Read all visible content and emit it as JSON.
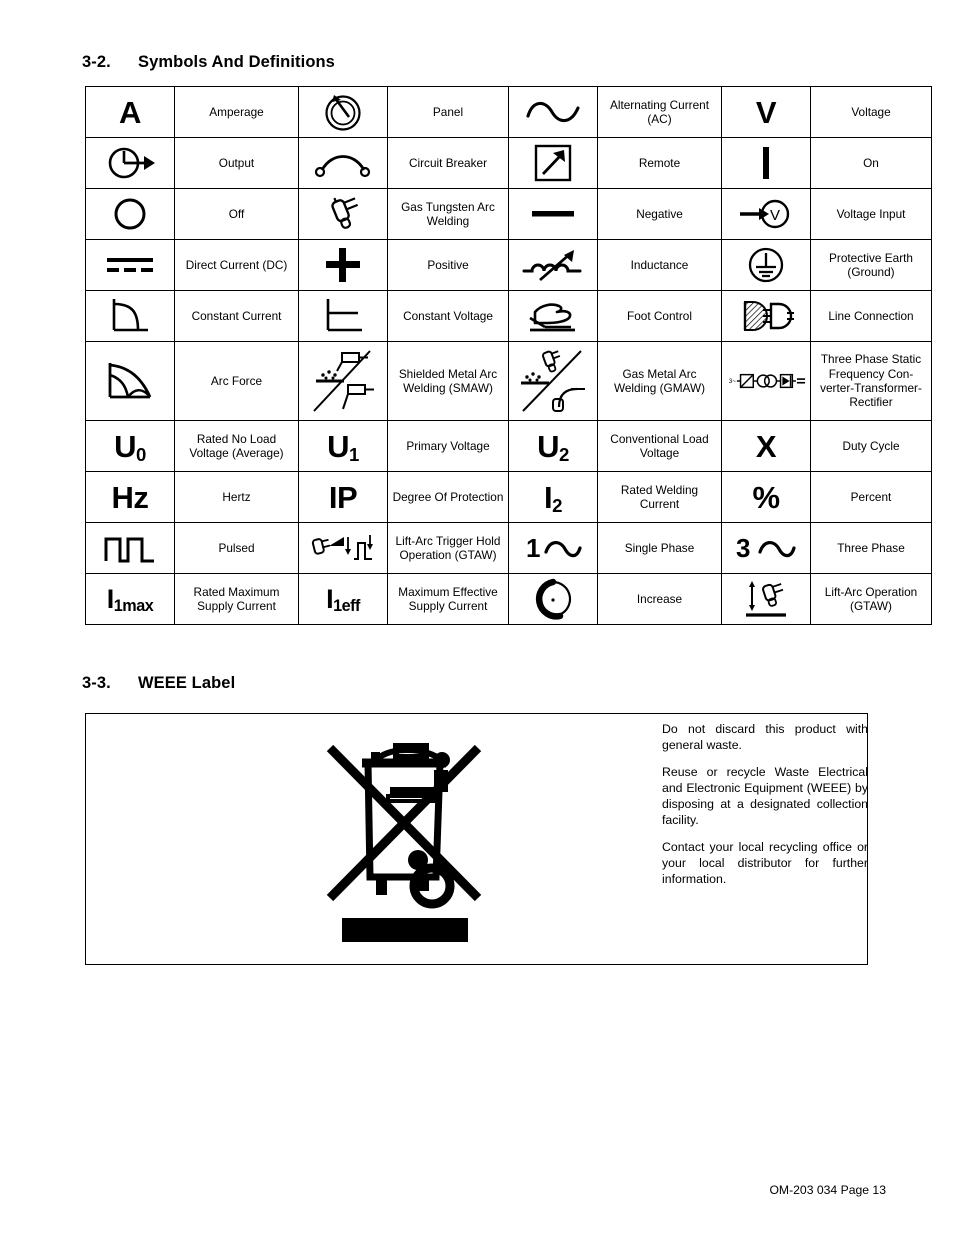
{
  "sections": {
    "symbols": {
      "number": "3-2.",
      "title": "Symbols And Definitions"
    },
    "weee": {
      "number": "3-3.",
      "title": "WEEE Label"
    }
  },
  "symbols_table": {
    "rows": [
      [
        {
          "icon": "amperage-a-symbol",
          "glyph": "A",
          "label": "Amperage"
        },
        {
          "icon": "panel-dial-symbol",
          "glyph": "",
          "label": "Panel"
        },
        {
          "icon": "alternating-current-sine-symbol",
          "glyph": "",
          "label": "Alternating Current (AC)"
        },
        {
          "icon": "voltage-v-symbol",
          "glyph": "V",
          "label": "Voltage"
        }
      ],
      [
        {
          "icon": "output-arrow-symbol",
          "glyph": "",
          "label": "Output"
        },
        {
          "icon": "circuit-breaker-symbol",
          "glyph": "",
          "label": "Circuit Breaker"
        },
        {
          "icon": "remote-arrow-box-symbol",
          "glyph": "",
          "label": "Remote"
        },
        {
          "icon": "on-bar-symbol",
          "glyph": "",
          "label": "On"
        }
      ],
      [
        {
          "icon": "off-circle-symbol",
          "glyph": "",
          "label": "Off"
        },
        {
          "icon": "gas-tungsten-arc-welding-torch-symbol",
          "glyph": "",
          "label": "Gas Tungsten Arc Welding"
        },
        {
          "icon": "negative-bar-symbol",
          "glyph": "",
          "label": "Negative"
        },
        {
          "icon": "voltage-input-symbol",
          "glyph": "",
          "label": "Voltage Input"
        }
      ],
      [
        {
          "icon": "direct-current-dc-symbol",
          "glyph": "",
          "label": "Direct Current (DC)"
        },
        {
          "icon": "positive-plus-symbol",
          "glyph": "",
          "label": "Positive"
        },
        {
          "icon": "inductance-coil-symbol",
          "glyph": "",
          "label": "Inductance"
        },
        {
          "icon": "protective-earth-ground-symbol",
          "glyph": "",
          "label": "Protective Earth (Ground)"
        }
      ],
      [
        {
          "icon": "constant-current-curve-symbol",
          "glyph": "",
          "label": "Constant Current"
        },
        {
          "icon": "constant-voltage-curve-symbol",
          "glyph": "",
          "label": "Constant Voltage"
        },
        {
          "icon": "foot-control-pedal-symbol",
          "glyph": "",
          "label": "Foot Control"
        },
        {
          "icon": "line-connection-plug-symbol",
          "glyph": "",
          "label": "Line Connection"
        }
      ],
      [
        {
          "icon": "arc-force-curve-symbol",
          "glyph": "",
          "label": "Arc Force"
        },
        {
          "icon": "shielded-metal-arc-welding-symbol",
          "glyph": "",
          "label": "Shielded Metal Arc Welding (SMAW)"
        },
        {
          "icon": "gas-metal-arc-welding-symbol",
          "glyph": "",
          "label": "Gas Metal Arc Welding (GMAW)"
        },
        {
          "icon": "three-phase-static-frequency-converter-symbol",
          "glyph": "",
          "label": "Three Phase Static Frequency Con-verter-Transformer-Rectifier"
        }
      ],
      [
        {
          "icon": "rated-no-load-voltage-symbol",
          "glyph": "U0",
          "label": "Rated No Load Voltage (Average)"
        },
        {
          "icon": "primary-voltage-symbol",
          "glyph": "U1",
          "label": "Primary Voltage"
        },
        {
          "icon": "conventional-load-voltage-symbol",
          "glyph": "U2",
          "label": "Conventional Load Voltage"
        },
        {
          "icon": "duty-cycle-x-symbol",
          "glyph": "X",
          "label": "Duty Cycle"
        }
      ],
      [
        {
          "icon": "hertz-hz-symbol",
          "glyph": "Hz",
          "label": "Hertz"
        },
        {
          "icon": "degree-of-protection-ip-symbol",
          "glyph": "IP",
          "label": "Degree Of Protection"
        },
        {
          "icon": "rated-welding-current-symbol",
          "glyph": "I2",
          "label": "Rated Welding Current"
        },
        {
          "icon": "percent-symbol",
          "glyph": "%",
          "label": "Percent"
        }
      ],
      [
        {
          "icon": "pulsed-square-wave-symbol",
          "glyph": "",
          "label": "Pulsed"
        },
        {
          "icon": "lift-arc-trigger-hold-symbol",
          "glyph": "",
          "label": "Lift-Arc Trigger Hold Operation (GTAW)"
        },
        {
          "icon": "single-phase-symbol",
          "glyph": "",
          "label": "Single Phase"
        },
        {
          "icon": "three-phase-symbol",
          "glyph": "",
          "label": "Three Phase"
        }
      ],
      [
        {
          "icon": "rated-maximum-supply-current-symbol",
          "glyph": "I1max",
          "label": "Rated Maximum Supply Current"
        },
        {
          "icon": "maximum-effective-supply-current-symbol",
          "glyph": "I1eff",
          "label": "Maximum Effective Supply Current"
        },
        {
          "icon": "increase-crescent-symbol",
          "glyph": "",
          "label": "Increase"
        },
        {
          "icon": "lift-arc-operation-symbol",
          "glyph": "",
          "label": "Lift-Arc Operation (GTAW)"
        }
      ]
    ],
    "glyph_parts": {
      "u0": {
        "base": "U",
        "sub": "0"
      },
      "u1": {
        "base": "U",
        "sub": "1"
      },
      "u2": {
        "base": "U",
        "sub": "2"
      },
      "i2": {
        "base": "I",
        "sub": "2"
      },
      "i1max": {
        "base": "I",
        "sub": "1max"
      },
      "i1eff": {
        "base": "I",
        "sub": "1eff"
      },
      "a": "A",
      "v": "V",
      "x": "X",
      "hz": "Hz",
      "ip": "IP",
      "percent": "%"
    },
    "labels": {
      "amperage": "Amperage",
      "panel": "Panel",
      "alternating_current": "Alternating Current (AC)",
      "voltage": "Voltage",
      "output": "Output",
      "circuit_breaker": "Circuit Breaker",
      "remote": "Remote",
      "on": "On",
      "off": "Off",
      "gtaw": "Gas Tungsten Arc Welding",
      "negative": "Negative",
      "voltage_input": "Voltage Input",
      "direct_current": "Direct Current (DC)",
      "positive": "Positive",
      "inductance": "Inductance",
      "protective_earth": "Protective Earth (Ground)",
      "constant_current": "Constant Current",
      "constant_voltage": "Constant Voltage",
      "foot_control": "Foot Control",
      "line_connection": "Line Connection",
      "arc_force": "Arc Force",
      "smaw": "Shielded Metal Arc Welding (SMAW)",
      "gmaw": "Gas Metal Arc Welding (GMAW)",
      "three_phase_converter": "Three Phase Static Frequency Con-verter-Transformer-Rectifier",
      "rated_no_load_voltage": "Rated No Load Voltage (Average)",
      "primary_voltage": "Primary Voltage",
      "conventional_load_voltage": "Conventional Load Voltage",
      "duty_cycle": "Duty Cycle",
      "hertz": "Hertz",
      "degree_of_protection": "Degree Of Protection",
      "rated_welding_current": "Rated Welding Current",
      "percent": "Percent",
      "pulsed": "Pulsed",
      "lift_arc_trigger": "Lift-Arc Trigger Hold Operation (GTAW)",
      "single_phase": "Single Phase",
      "three_phase": "Three Phase",
      "rated_maximum_supply_current": "Rated Maximum Supply Current",
      "maximum_effective_supply_current": "Maximum Effective Supply Current",
      "increase": "Increase",
      "lift_arc_operation": "Lift-Arc Operation (GTAW)"
    }
  },
  "weee": {
    "icon": "crossed-out-wheeled-bin-icon",
    "paragraphs": [
      "Do not discard this product with general waste.",
      "Reuse or recycle Waste Electrical and Electronic Equipment (WEEE) by disposing at a designated collection facility.",
      "Contact your local recycling office or your local distributor for further information."
    ]
  },
  "footer": {
    "text": "OM-203 034 Page 13"
  },
  "colors": {
    "ink": "#000000",
    "paper": "#ffffff"
  }
}
